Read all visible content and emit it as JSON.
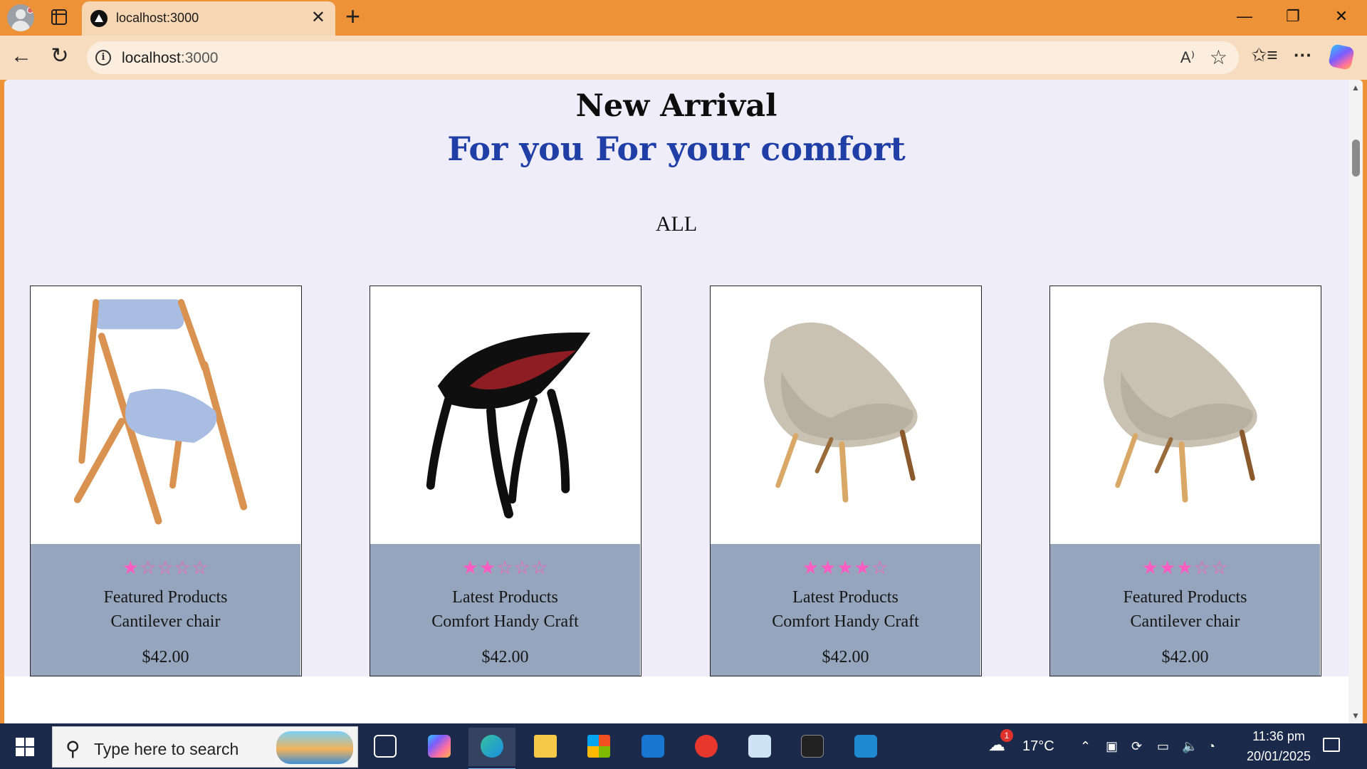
{
  "browser": {
    "tab_title": "localhost:3000",
    "url_host": "localhost",
    "url_port": ":3000",
    "icons": {
      "profile": "profile-avatar-icon",
      "tab_actions": "tab-actions-icon",
      "favicon": "site-favicon",
      "close_tab": "close-icon",
      "new_tab": "plus-icon",
      "back": "arrow-left-icon",
      "reload": "reload-icon",
      "site_info": "info-icon",
      "read_aloud": "read-aloud-icon",
      "add_favorite": "star-icon",
      "favorites": "favorites-icon",
      "more": "more-icon",
      "copilot": "copilot-icon"
    },
    "glyphs": {
      "close": "✕",
      "new_tab": "+",
      "minimize": "—",
      "maximize": "❐",
      "window_close": "✕",
      "back": "←",
      "reload": "↻",
      "info": "i",
      "read_aloud": "A⁾",
      "add_favorite": "☆",
      "favorites": "✩≡",
      "more": "···"
    }
  },
  "page": {
    "heading": "New Arrival",
    "subheading": "For you For your comfort",
    "filter_label": "ALL",
    "colors": {
      "background": "#eeedf9",
      "subheading": "#1f3fa6",
      "card_info_bg": "#95a5bd",
      "star": "#ff5cc1"
    },
    "products": [
      {
        "category": "Featured Products",
        "name": "Cantilever chair",
        "price": "$42.00",
        "rating": 1,
        "max_rating": 5,
        "image": "wooden-folding-chair-image"
      },
      {
        "category": "Latest Products",
        "name": "Comfort Handy Craft",
        "price": "$42.00",
        "rating": 2,
        "max_rating": 5,
        "image": "black-red-designer-chair-image"
      },
      {
        "category": "Latest Products",
        "name": "Comfort Handy Craft",
        "price": "$42.00",
        "rating": 4,
        "max_rating": 5,
        "image": "woven-lounge-chair-image"
      },
      {
        "category": "Featured Products",
        "name": "Cantilever chair",
        "price": "$42.00",
        "rating": 3,
        "max_rating": 5,
        "image": "woven-lounge-chair-image"
      }
    ]
  },
  "taskbar": {
    "search_placeholder": "Type here to search",
    "weather_temp": "17°C",
    "weather_badge": "1",
    "time": "11:36 pm",
    "date": "20/01/2025",
    "apps": [
      "task-view-icon",
      "copilot-app-icon",
      "edge-icon",
      "file-explorer-icon",
      "microsoft-store-icon",
      "outlook-icon",
      "wps-office-icon",
      "notepad-icon",
      "terminal-icon",
      "vscode-icon"
    ],
    "tray_glyphs": {
      "chevron": "⌃",
      "volume": "🔈",
      "wifi": "◔"
    }
  }
}
